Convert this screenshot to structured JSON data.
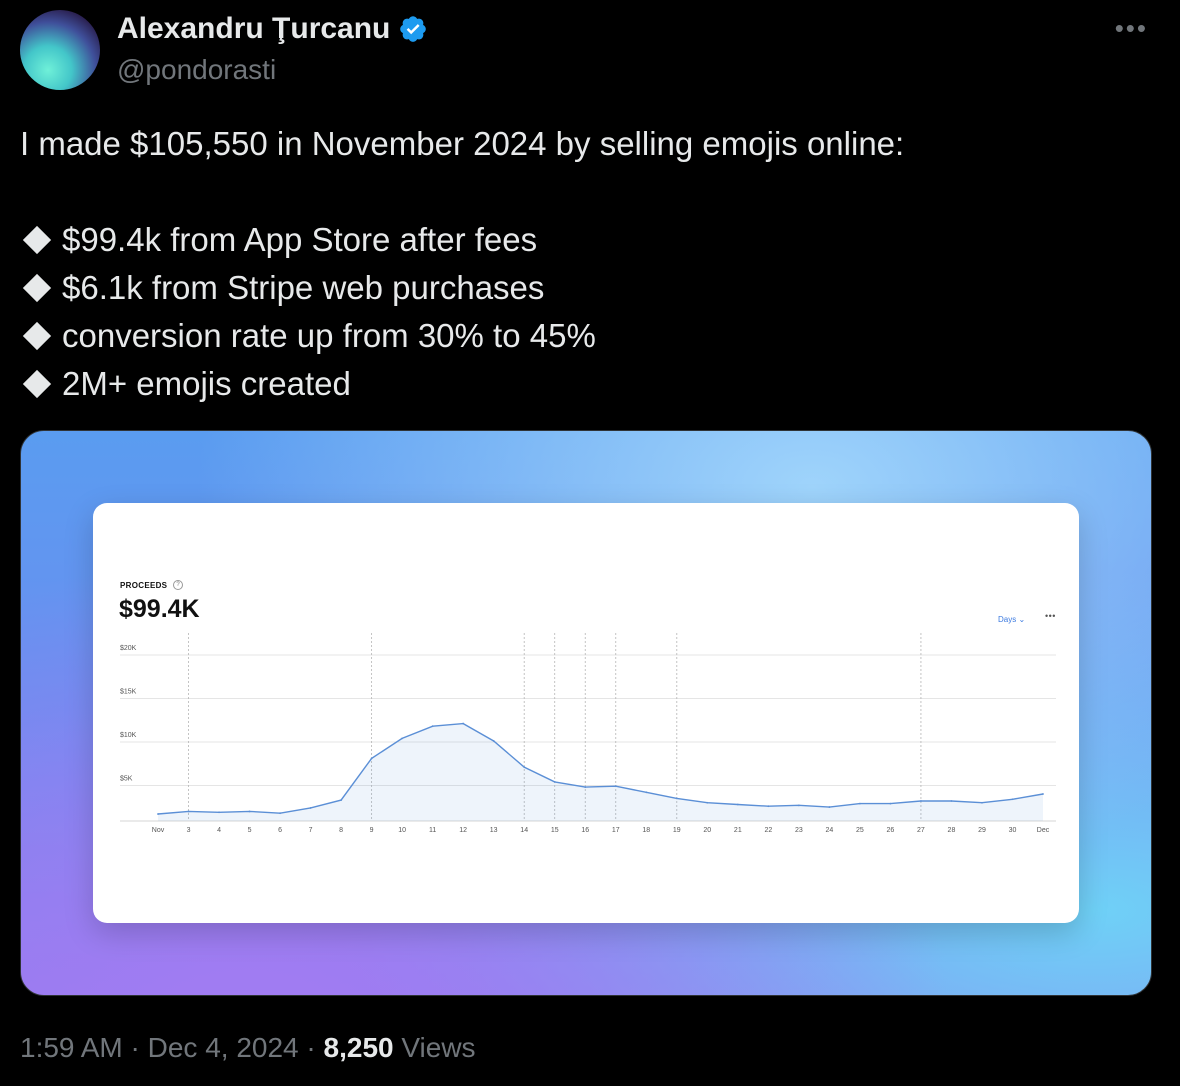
{
  "author": {
    "name": "Alexandru Ţurcanu",
    "handle": "@pondorasti"
  },
  "tweet": {
    "intro": "I made $105,550 in November 2024 by selling emojis online:",
    "bullets": [
      "$99.4k from App Store after fees",
      "$6.1k from Stripe web purchases",
      "conversion rate up from 30% to 45%",
      "2M+ emojis created"
    ]
  },
  "media": {
    "label": "PROCEEDS",
    "help": "?",
    "total": "$99.4K",
    "period_select": "Days ⌄",
    "more": "•••"
  },
  "chart_data": {
    "type": "area",
    "x": [
      "Nov",
      "3",
      "4",
      "5",
      "6",
      "7",
      "8",
      "9",
      "10",
      "11",
      "12",
      "13",
      "14",
      "15",
      "16",
      "17",
      "18",
      "19",
      "20",
      "21",
      "22",
      "23",
      "24",
      "25",
      "26",
      "27",
      "28",
      "29",
      "30",
      "Dec"
    ],
    "y": [
      800,
      1100,
      1000,
      1100,
      900,
      1500,
      2400,
      7200,
      9500,
      10900,
      11200,
      9200,
      6200,
      4500,
      3900,
      4000,
      3300,
      2600,
      2100,
      1900,
      1700,
      1800,
      1600,
      2000,
      2000,
      2300,
      2300,
      2100,
      2500,
      3100
    ],
    "yticks": [
      "$20K",
      "$15K",
      "$10K",
      "$5K"
    ],
    "ytick_values": [
      20000,
      15000,
      10000,
      5000
    ],
    "ylim": [
      0,
      20000
    ],
    "dashed_markers": [
      "3",
      "9",
      "14",
      "15",
      "16",
      "17",
      "19",
      "27"
    ],
    "line_color": "#5b8fd6"
  },
  "footer": {
    "time": "1:59 AM",
    "separator": "·",
    "date": "Dec 4, 2024",
    "views_count": "8,250",
    "views_label": "Views"
  },
  "colors": {
    "verified": "#1d9bf0",
    "muted": "#71767b",
    "text": "#e7e9ea"
  }
}
